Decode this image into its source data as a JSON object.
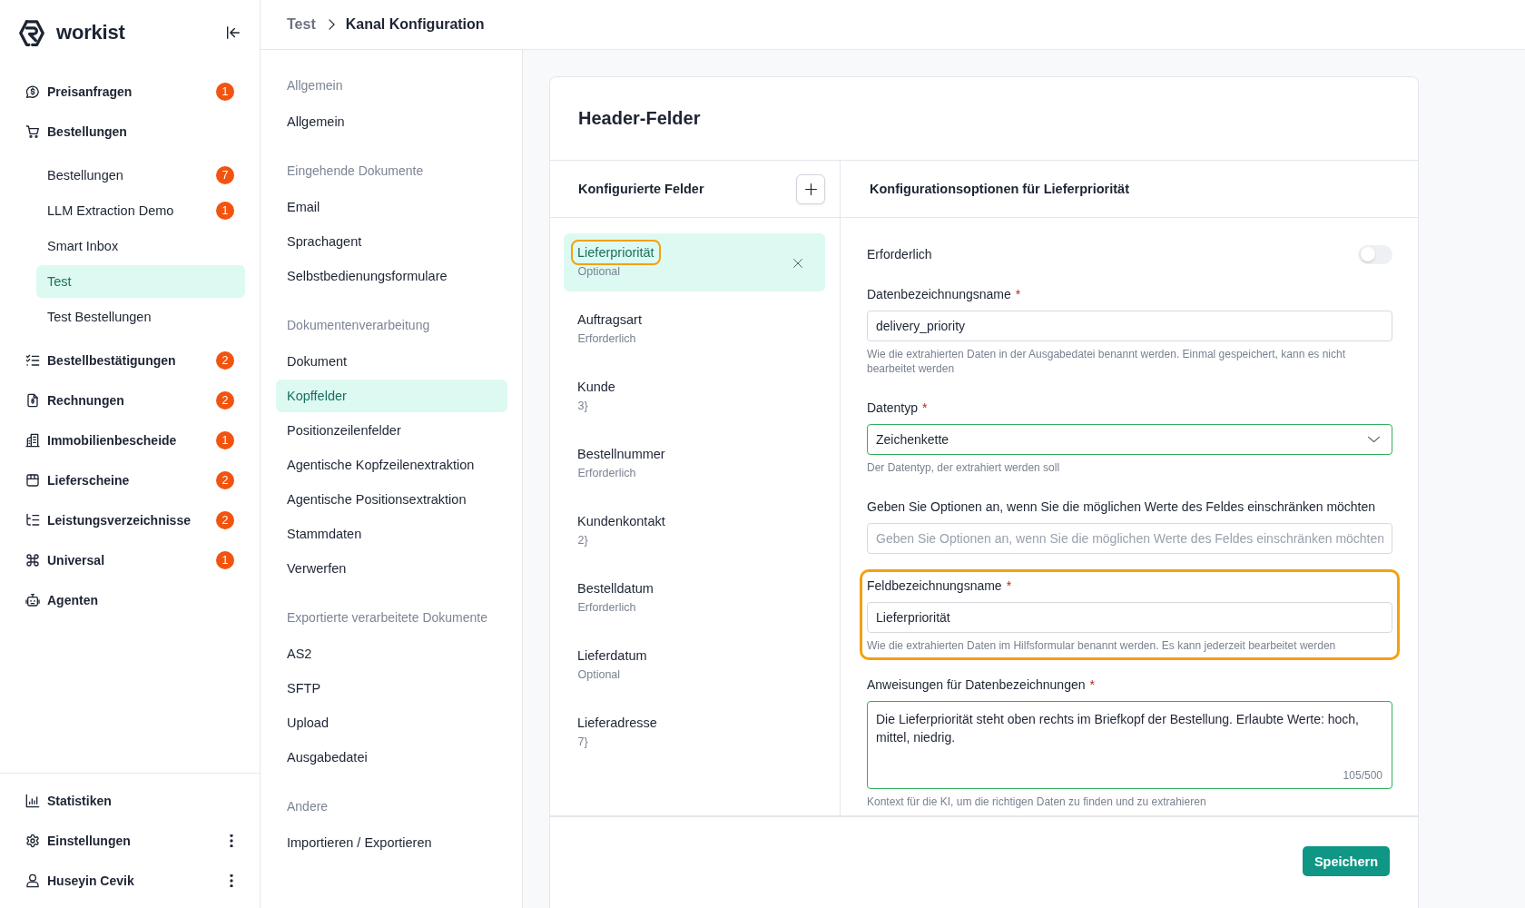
{
  "sidebar": {
    "logo_text": "workist",
    "items": [
      {
        "label": "Preisanfragen",
        "badge": "1",
        "selected": false
      },
      {
        "label": "Bestellungen",
        "selected": false,
        "children": [
          {
            "label": "Bestellungen",
            "badge": "7",
            "selected": false
          },
          {
            "label": "LLM Extraction Demo",
            "badge": "1",
            "selected": false
          },
          {
            "label": "Smart Inbox",
            "selected": false
          },
          {
            "label": "Test",
            "selected": true
          },
          {
            "label": "Test Bestellungen",
            "selected": false
          }
        ]
      },
      {
        "label": "Bestellbestätigungen",
        "badge": "2",
        "selected": false
      },
      {
        "label": "Rechnungen",
        "badge": "2",
        "selected": false
      },
      {
        "label": "Immobilienbescheide",
        "badge": "1",
        "selected": false
      },
      {
        "label": "Lieferscheine",
        "badge": "2",
        "selected": false
      },
      {
        "label": "Leistungsverzeichnisse",
        "badge": "2",
        "selected": false
      },
      {
        "label": "Universal",
        "badge": "1",
        "selected": false
      },
      {
        "label": "Agenten",
        "selected": false
      }
    ],
    "footer_items": [
      {
        "label": "Statistiken",
        "has_menu": false
      },
      {
        "label": "Einstellungen",
        "has_menu": true
      },
      {
        "label": "Huseyin Cevik",
        "has_menu": true
      }
    ]
  },
  "breadcrumb": [
    {
      "label": "Test",
      "current": false
    },
    {
      "label": "Kanal Konfiguration",
      "current": true
    }
  ],
  "settings_nav": [
    {
      "title": "Allgemein",
      "items": [
        {
          "label": "Allgemein",
          "selected": false
        }
      ]
    },
    {
      "title": "Eingehende Dokumente",
      "items": [
        {
          "label": "Email",
          "selected": false
        },
        {
          "label": "Sprachagent",
          "selected": false
        },
        {
          "label": "Selbstbedienungsformulare",
          "selected": false
        }
      ]
    },
    {
      "title": "Dokumentenverarbeitung",
      "items": [
        {
          "label": "Dokument",
          "selected": false
        },
        {
          "label": "Kopffelder",
          "selected": true
        },
        {
          "label": "Positionzeilenfelder",
          "selected": false
        },
        {
          "label": "Agentische Kopfzeilenextraktion",
          "selected": false
        },
        {
          "label": "Agentische Positionsextraktion",
          "selected": false
        },
        {
          "label": "Stammdaten",
          "selected": false
        },
        {
          "label": "Verwerfen",
          "selected": false
        }
      ]
    },
    {
      "title": "Exportierte verarbeitete Dokumente",
      "items": [
        {
          "label": "AS2",
          "selected": false
        },
        {
          "label": "SFTP",
          "selected": false
        },
        {
          "label": "Upload",
          "selected": false
        },
        {
          "label": "Ausgabedatei",
          "selected": false
        }
      ]
    },
    {
      "title": "Andere",
      "items": [
        {
          "label": "Importieren / Exportieren",
          "selected": false
        }
      ]
    }
  ],
  "card": {
    "title": "Header-Felder",
    "fields_panel": {
      "title": "Konfigurierte Felder",
      "items": [
        {
          "name": "Lieferpriorität",
          "status": "Optional",
          "selected": true,
          "highlighted": true
        },
        {
          "name": "Auftragsart",
          "status": "Erforderlich",
          "selected": false,
          "highlighted": false
        },
        {
          "name": "Kunde",
          "status": "3}",
          "selected": false,
          "highlighted": false
        },
        {
          "name": "Bestellnummer",
          "status": "Erforderlich",
          "selected": false,
          "highlighted": false
        },
        {
          "name": "Kundenkontakt",
          "status": "2}",
          "selected": false,
          "highlighted": false
        },
        {
          "name": "Bestelldatum",
          "status": "Erforderlich",
          "selected": false,
          "highlighted": false
        },
        {
          "name": "Lieferdatum",
          "status": "Optional",
          "selected": false,
          "highlighted": false
        },
        {
          "name": "Lieferadresse",
          "status": "7}",
          "selected": false,
          "highlighted": false
        }
      ]
    },
    "config_panel": {
      "title": "Konfigurationsoptionen für Lieferpriorität",
      "form": [
        {
          "kind": "toggle",
          "label": "Erforderlich",
          "on": false
        },
        {
          "kind": "input",
          "label": "Datenbezeichnungsname",
          "required_mark": "*",
          "value": "delivery_priority",
          "help": "Wie die extrahierten Daten in der Ausgabedatei benannt werden. Einmal gespeichert, kann es nicht bearbeitet werden",
          "valid": false,
          "highlighted": false
        },
        {
          "kind": "select",
          "label": "Datentyp",
          "required_mark": "*",
          "value": "Zeichenkette",
          "help": "Der Datentyp, der extrahiert werden soll",
          "valid": true,
          "highlighted": false
        },
        {
          "kind": "input",
          "label": "Geben Sie Optionen an, wenn Sie die möglichen Werte des Feldes einschränken möchten",
          "placeholder": "Geben Sie Optionen an, wenn Sie die möglichen Werte des Feldes einschränken möchten",
          "valid": false,
          "highlighted": false
        },
        {
          "kind": "input",
          "label": "Feldbezeichnungsname",
          "required_mark": "*",
          "value": "Lieferpriorität",
          "help": "Wie die extrahierten Daten im Hilfsformular benannt werden. Es kann jederzeit bearbeitet werden",
          "valid": false,
          "highlighted": true
        },
        {
          "kind": "textarea",
          "label": "Anweisungen für Datenbezeichnungen",
          "required_mark": "*",
          "value": "Die Lieferpriorität steht oben rechts im Briefkopf der Bestellung. Erlaubte Werte: hoch, mittel, niedrig.",
          "counter": "105/500",
          "help": "Kontext für die KI, um die richtigen Daten zu finden und zu extrahieren",
          "valid": true,
          "highlighted": false
        }
      ]
    },
    "save_button": "Speichern"
  }
}
